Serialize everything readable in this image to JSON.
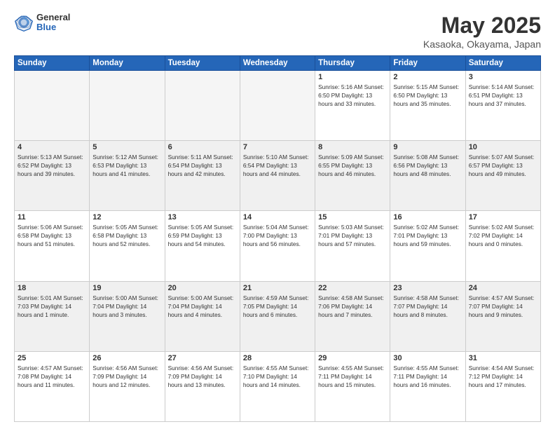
{
  "logo": {
    "general": "General",
    "blue": "Blue"
  },
  "title": {
    "month_year": "May 2025",
    "location": "Kasaoka, Okayama, Japan"
  },
  "days_of_week": [
    "Sunday",
    "Monday",
    "Tuesday",
    "Wednesday",
    "Thursday",
    "Friday",
    "Saturday"
  ],
  "weeks": [
    [
      {
        "day": "",
        "info": ""
      },
      {
        "day": "",
        "info": ""
      },
      {
        "day": "",
        "info": ""
      },
      {
        "day": "",
        "info": ""
      },
      {
        "day": "1",
        "info": "Sunrise: 5:16 AM\nSunset: 6:50 PM\nDaylight: 13 hours\nand 33 minutes."
      },
      {
        "day": "2",
        "info": "Sunrise: 5:15 AM\nSunset: 6:50 PM\nDaylight: 13 hours\nand 35 minutes."
      },
      {
        "day": "3",
        "info": "Sunrise: 5:14 AM\nSunset: 6:51 PM\nDaylight: 13 hours\nand 37 minutes."
      }
    ],
    [
      {
        "day": "4",
        "info": "Sunrise: 5:13 AM\nSunset: 6:52 PM\nDaylight: 13 hours\nand 39 minutes."
      },
      {
        "day": "5",
        "info": "Sunrise: 5:12 AM\nSunset: 6:53 PM\nDaylight: 13 hours\nand 41 minutes."
      },
      {
        "day": "6",
        "info": "Sunrise: 5:11 AM\nSunset: 6:54 PM\nDaylight: 13 hours\nand 42 minutes."
      },
      {
        "day": "7",
        "info": "Sunrise: 5:10 AM\nSunset: 6:54 PM\nDaylight: 13 hours\nand 44 minutes."
      },
      {
        "day": "8",
        "info": "Sunrise: 5:09 AM\nSunset: 6:55 PM\nDaylight: 13 hours\nand 46 minutes."
      },
      {
        "day": "9",
        "info": "Sunrise: 5:08 AM\nSunset: 6:56 PM\nDaylight: 13 hours\nand 48 minutes."
      },
      {
        "day": "10",
        "info": "Sunrise: 5:07 AM\nSunset: 6:57 PM\nDaylight: 13 hours\nand 49 minutes."
      }
    ],
    [
      {
        "day": "11",
        "info": "Sunrise: 5:06 AM\nSunset: 6:58 PM\nDaylight: 13 hours\nand 51 minutes."
      },
      {
        "day": "12",
        "info": "Sunrise: 5:05 AM\nSunset: 6:58 PM\nDaylight: 13 hours\nand 52 minutes."
      },
      {
        "day": "13",
        "info": "Sunrise: 5:05 AM\nSunset: 6:59 PM\nDaylight: 13 hours\nand 54 minutes."
      },
      {
        "day": "14",
        "info": "Sunrise: 5:04 AM\nSunset: 7:00 PM\nDaylight: 13 hours\nand 56 minutes."
      },
      {
        "day": "15",
        "info": "Sunrise: 5:03 AM\nSunset: 7:01 PM\nDaylight: 13 hours\nand 57 minutes."
      },
      {
        "day": "16",
        "info": "Sunrise: 5:02 AM\nSunset: 7:01 PM\nDaylight: 13 hours\nand 59 minutes."
      },
      {
        "day": "17",
        "info": "Sunrise: 5:02 AM\nSunset: 7:02 PM\nDaylight: 14 hours\nand 0 minutes."
      }
    ],
    [
      {
        "day": "18",
        "info": "Sunrise: 5:01 AM\nSunset: 7:03 PM\nDaylight: 14 hours\nand 1 minute."
      },
      {
        "day": "19",
        "info": "Sunrise: 5:00 AM\nSunset: 7:04 PM\nDaylight: 14 hours\nand 3 minutes."
      },
      {
        "day": "20",
        "info": "Sunrise: 5:00 AM\nSunset: 7:04 PM\nDaylight: 14 hours\nand 4 minutes."
      },
      {
        "day": "21",
        "info": "Sunrise: 4:59 AM\nSunset: 7:05 PM\nDaylight: 14 hours\nand 6 minutes."
      },
      {
        "day": "22",
        "info": "Sunrise: 4:58 AM\nSunset: 7:06 PM\nDaylight: 14 hours\nand 7 minutes."
      },
      {
        "day": "23",
        "info": "Sunrise: 4:58 AM\nSunset: 7:07 PM\nDaylight: 14 hours\nand 8 minutes."
      },
      {
        "day": "24",
        "info": "Sunrise: 4:57 AM\nSunset: 7:07 PM\nDaylight: 14 hours\nand 9 minutes."
      }
    ],
    [
      {
        "day": "25",
        "info": "Sunrise: 4:57 AM\nSunset: 7:08 PM\nDaylight: 14 hours\nand 11 minutes."
      },
      {
        "day": "26",
        "info": "Sunrise: 4:56 AM\nSunset: 7:09 PM\nDaylight: 14 hours\nand 12 minutes."
      },
      {
        "day": "27",
        "info": "Sunrise: 4:56 AM\nSunset: 7:09 PM\nDaylight: 14 hours\nand 13 minutes."
      },
      {
        "day": "28",
        "info": "Sunrise: 4:55 AM\nSunset: 7:10 PM\nDaylight: 14 hours\nand 14 minutes."
      },
      {
        "day": "29",
        "info": "Sunrise: 4:55 AM\nSunset: 7:11 PM\nDaylight: 14 hours\nand 15 minutes."
      },
      {
        "day": "30",
        "info": "Sunrise: 4:55 AM\nSunset: 7:11 PM\nDaylight: 14 hours\nand 16 minutes."
      },
      {
        "day": "31",
        "info": "Sunrise: 4:54 AM\nSunset: 7:12 PM\nDaylight: 14 hours\nand 17 minutes."
      }
    ]
  ]
}
